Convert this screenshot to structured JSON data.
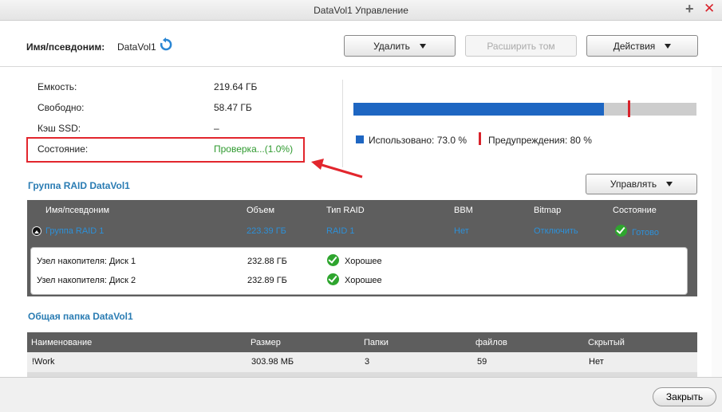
{
  "window": {
    "title": "DataVol1 Управление"
  },
  "header": {
    "alias_label": "Имя/псевдоним:",
    "alias_value": "DataVol1",
    "buttons": {
      "delete": "Удалить",
      "expand": "Расширить том",
      "actions": "Действия"
    }
  },
  "info": {
    "capacity_label": "Емкость:",
    "capacity_value": "219.64 ГБ",
    "free_label": "Свободно:",
    "free_value": "58.47 ГБ",
    "ssd_label": "Кэш SSD:",
    "ssd_value": "–",
    "state_label": "Состояние:",
    "state_value": "Проверка...(1.0%)"
  },
  "usage": {
    "used_fraction": 0.73,
    "warn_fraction": 0.8,
    "used_label": "Использовано: 73.0 %",
    "warn_label": "Предупреждения: 80 %",
    "used_color": "#1e66c2",
    "warn_color": "#d8222b"
  },
  "raid": {
    "title": "Группа RAID DataVol1",
    "manage_button": "Управлять",
    "columns": [
      "Имя/псевдоним",
      "Объем",
      "Тип RAID",
      "BBM",
      "Bitmap",
      "Состояние"
    ],
    "group": {
      "name": "Группа RAID 1",
      "size": "223.39 ГБ",
      "type": "RAID 1",
      "bbm": "Нет",
      "bitmap": "Отключить",
      "state": "Готово"
    },
    "disks": [
      {
        "name": "Узел накопителя: Диск 1",
        "size": "232.88 ГБ",
        "state": "Хорошее"
      },
      {
        "name": "Узел накопителя: Диск 2",
        "size": "232.89 ГБ",
        "state": "Хорошее"
      }
    ]
  },
  "share": {
    "title": "Общая папка DataVol1",
    "columns": [
      "Наименование",
      "Размер",
      "Папки",
      "файлов",
      "Скрытый"
    ],
    "rows": [
      {
        "name": "!Work",
        "size": "303.98 МБ",
        "folders": "3",
        "files": "59",
        "hidden": "Нет"
      }
    ]
  },
  "footer": {
    "close_button": "Закрыть"
  }
}
